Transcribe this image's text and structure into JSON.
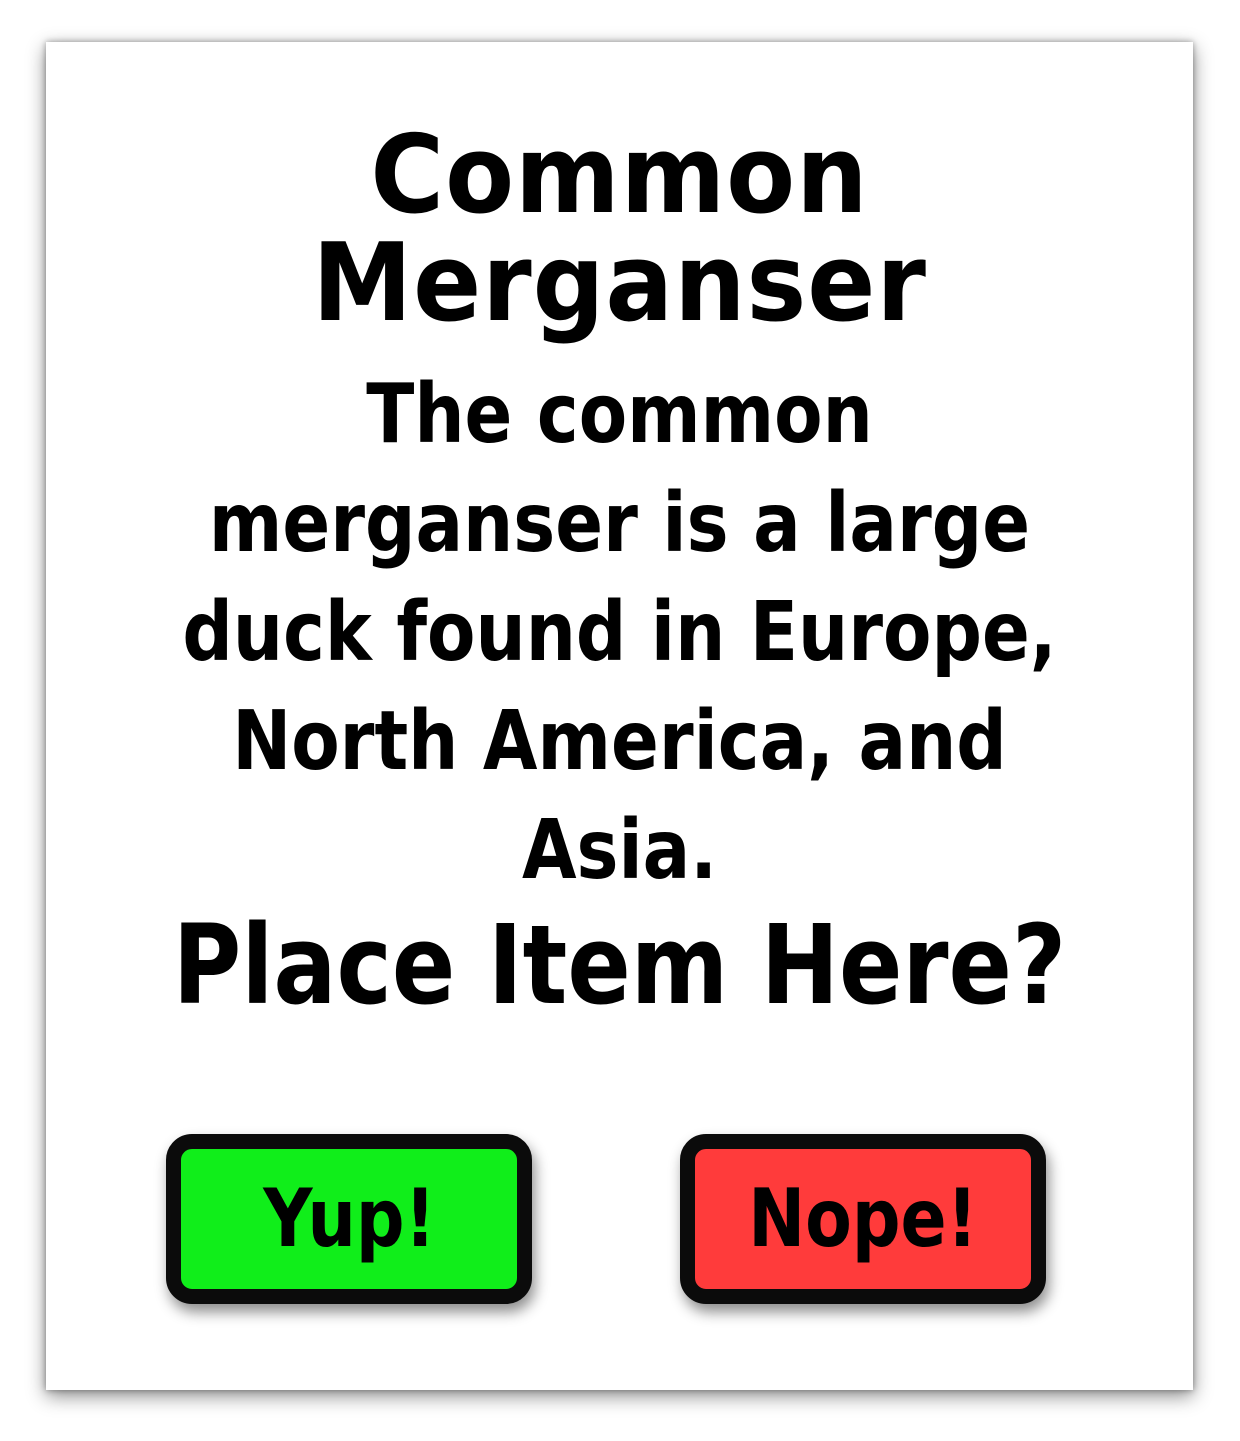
{
  "card": {
    "title": "Common Merganser",
    "description": "The common merganser is a large duck found in Europe, North America, and Asia.",
    "prompt": "Place Item Here?"
  },
  "buttons": {
    "yes_label": "Yup!",
    "no_label": "Nope!",
    "yes_color": "#10ee1a",
    "no_color": "#ff3b3b"
  }
}
